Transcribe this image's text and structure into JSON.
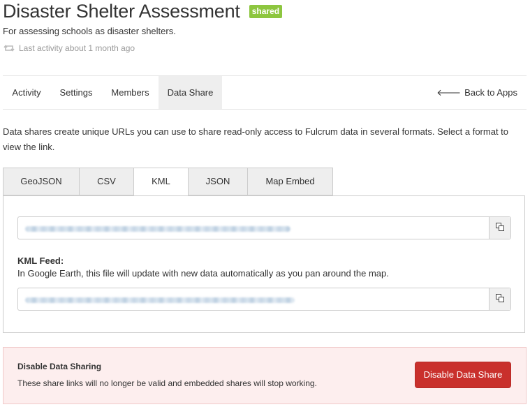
{
  "header": {
    "title": "Disaster Shelter Assessment",
    "badge": "shared",
    "subtitle": "For assessing schools as disaster shelters.",
    "last_activity": "Last activity about 1 month ago"
  },
  "nav": {
    "tabs": [
      {
        "label": "Activity"
      },
      {
        "label": "Settings"
      },
      {
        "label": "Members"
      },
      {
        "label": "Data Share",
        "active": true
      }
    ],
    "back_label": "Back to Apps"
  },
  "intro": "Data shares create unique URLs you can use to share read-only access to Fulcrum data in several formats. Select a format to view the link.",
  "formats": {
    "tabs": [
      {
        "label": "GeoJSON"
      },
      {
        "label": "CSV"
      },
      {
        "label": "KML",
        "active": true
      },
      {
        "label": "JSON"
      },
      {
        "label": "Map Embed"
      }
    ]
  },
  "kml_feed": {
    "label": "KML Feed:",
    "description": "In Google Earth, this file will update with new data automatically as you pan around the map."
  },
  "danger": {
    "title": "Disable Data Sharing",
    "description": "These share links will no longer be valid and embedded shares will stop working.",
    "button_label": "Disable Data Share"
  },
  "colors": {
    "badge": "#8dc63f",
    "danger_button": "#c9302c",
    "danger_background": "#fdeeee"
  }
}
